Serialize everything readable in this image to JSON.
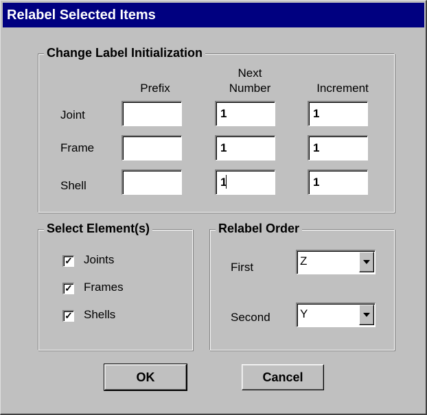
{
  "window": {
    "title": "Relabel Selected Items"
  },
  "label_init": {
    "title": "Change Label Initialization",
    "columns": {
      "prefix": "Prefix",
      "next_number_line1": "Next",
      "next_number_line2": "Number",
      "increment": "Increment"
    },
    "rows": [
      {
        "label": "Joint",
        "prefix": "",
        "next_number": "1",
        "increment": "1"
      },
      {
        "label": "Frame",
        "prefix": "",
        "next_number": "1",
        "increment": "1"
      },
      {
        "label": "Shell",
        "prefix": "",
        "next_number": "1",
        "increment": "1"
      }
    ]
  },
  "select_elements": {
    "title": "Select Element(s)",
    "items": [
      {
        "label": "Joints",
        "checked": true,
        "mark": "✓"
      },
      {
        "label": "Frames",
        "checked": true,
        "mark": "✓"
      },
      {
        "label": "Shells",
        "checked": true,
        "mark": "✓"
      }
    ]
  },
  "relabel_order": {
    "title": "Relabel Order",
    "first": {
      "label": "First",
      "value": "Z"
    },
    "second": {
      "label": "Second",
      "value": "Y"
    }
  },
  "buttons": {
    "ok": "OK",
    "cancel": "Cancel"
  }
}
